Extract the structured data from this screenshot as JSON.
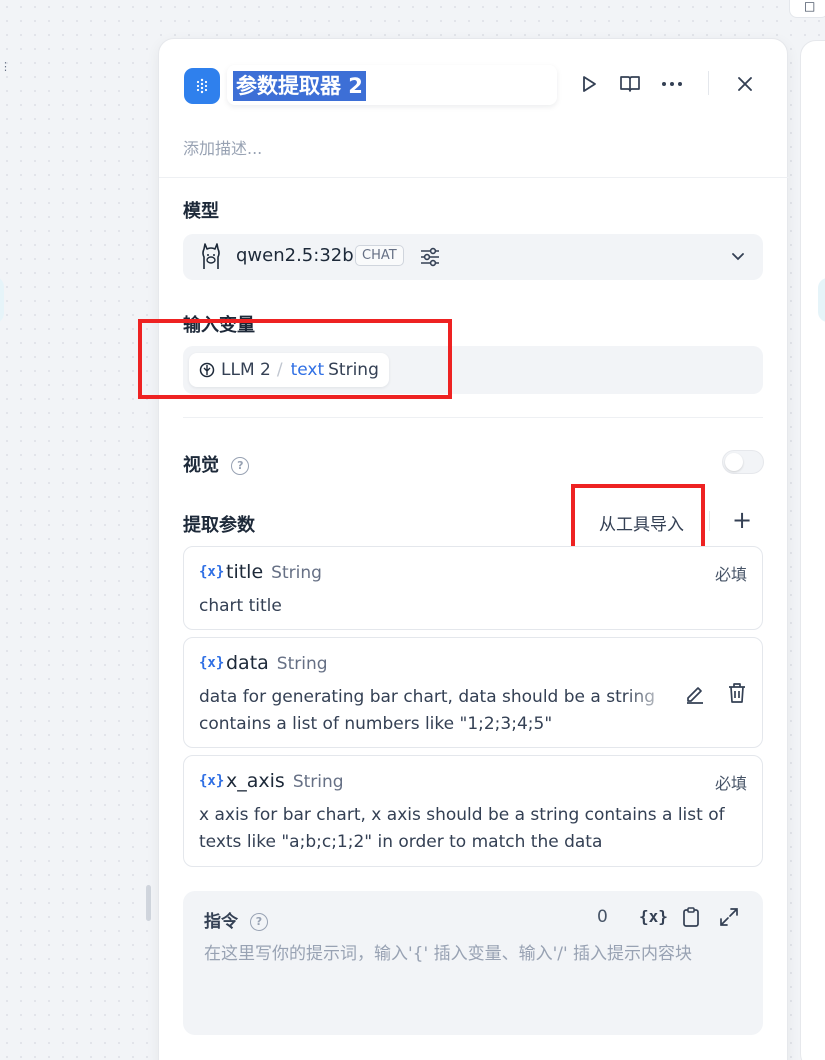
{
  "node": {
    "title": "参数提取器 2",
    "description_placeholder": "添加描述..."
  },
  "model": {
    "label": "模型",
    "name": "qwen2.5:32b",
    "mode_badge": "CHAT"
  },
  "input_vars": {
    "label": "输入变量",
    "source": "LLM 2",
    "separator": "/",
    "var_name": "text",
    "var_type": "String"
  },
  "vision": {
    "label": "视觉",
    "enabled": false
  },
  "extract": {
    "label": "提取参数",
    "import_label": "从工具导入",
    "params": [
      {
        "icon": "{x}",
        "name": "title",
        "type": "String",
        "required": "必填",
        "description": "chart title"
      },
      {
        "icon": "{x}",
        "name": "data",
        "type": "String",
        "description": "data for generating bar chart, data should be a string contains a list of numbers like \"1;2;3;4;5\""
      },
      {
        "icon": "{x}",
        "name": "x_axis",
        "type": "String",
        "required": "必填",
        "description": "x axis for bar chart, x axis should be a string contains a list of texts like \"a;b;c;1;2\" in order to match the data"
      }
    ]
  },
  "instruction": {
    "label": "指令",
    "count": "0",
    "var_icon_label": "{x}",
    "placeholder": "在这里写你的提示词，输入'{' 插入变量、输入'/' 插入提示内容块"
  },
  "colors": {
    "accent": "#2f80ed",
    "highlight_box": "#ee2222"
  }
}
